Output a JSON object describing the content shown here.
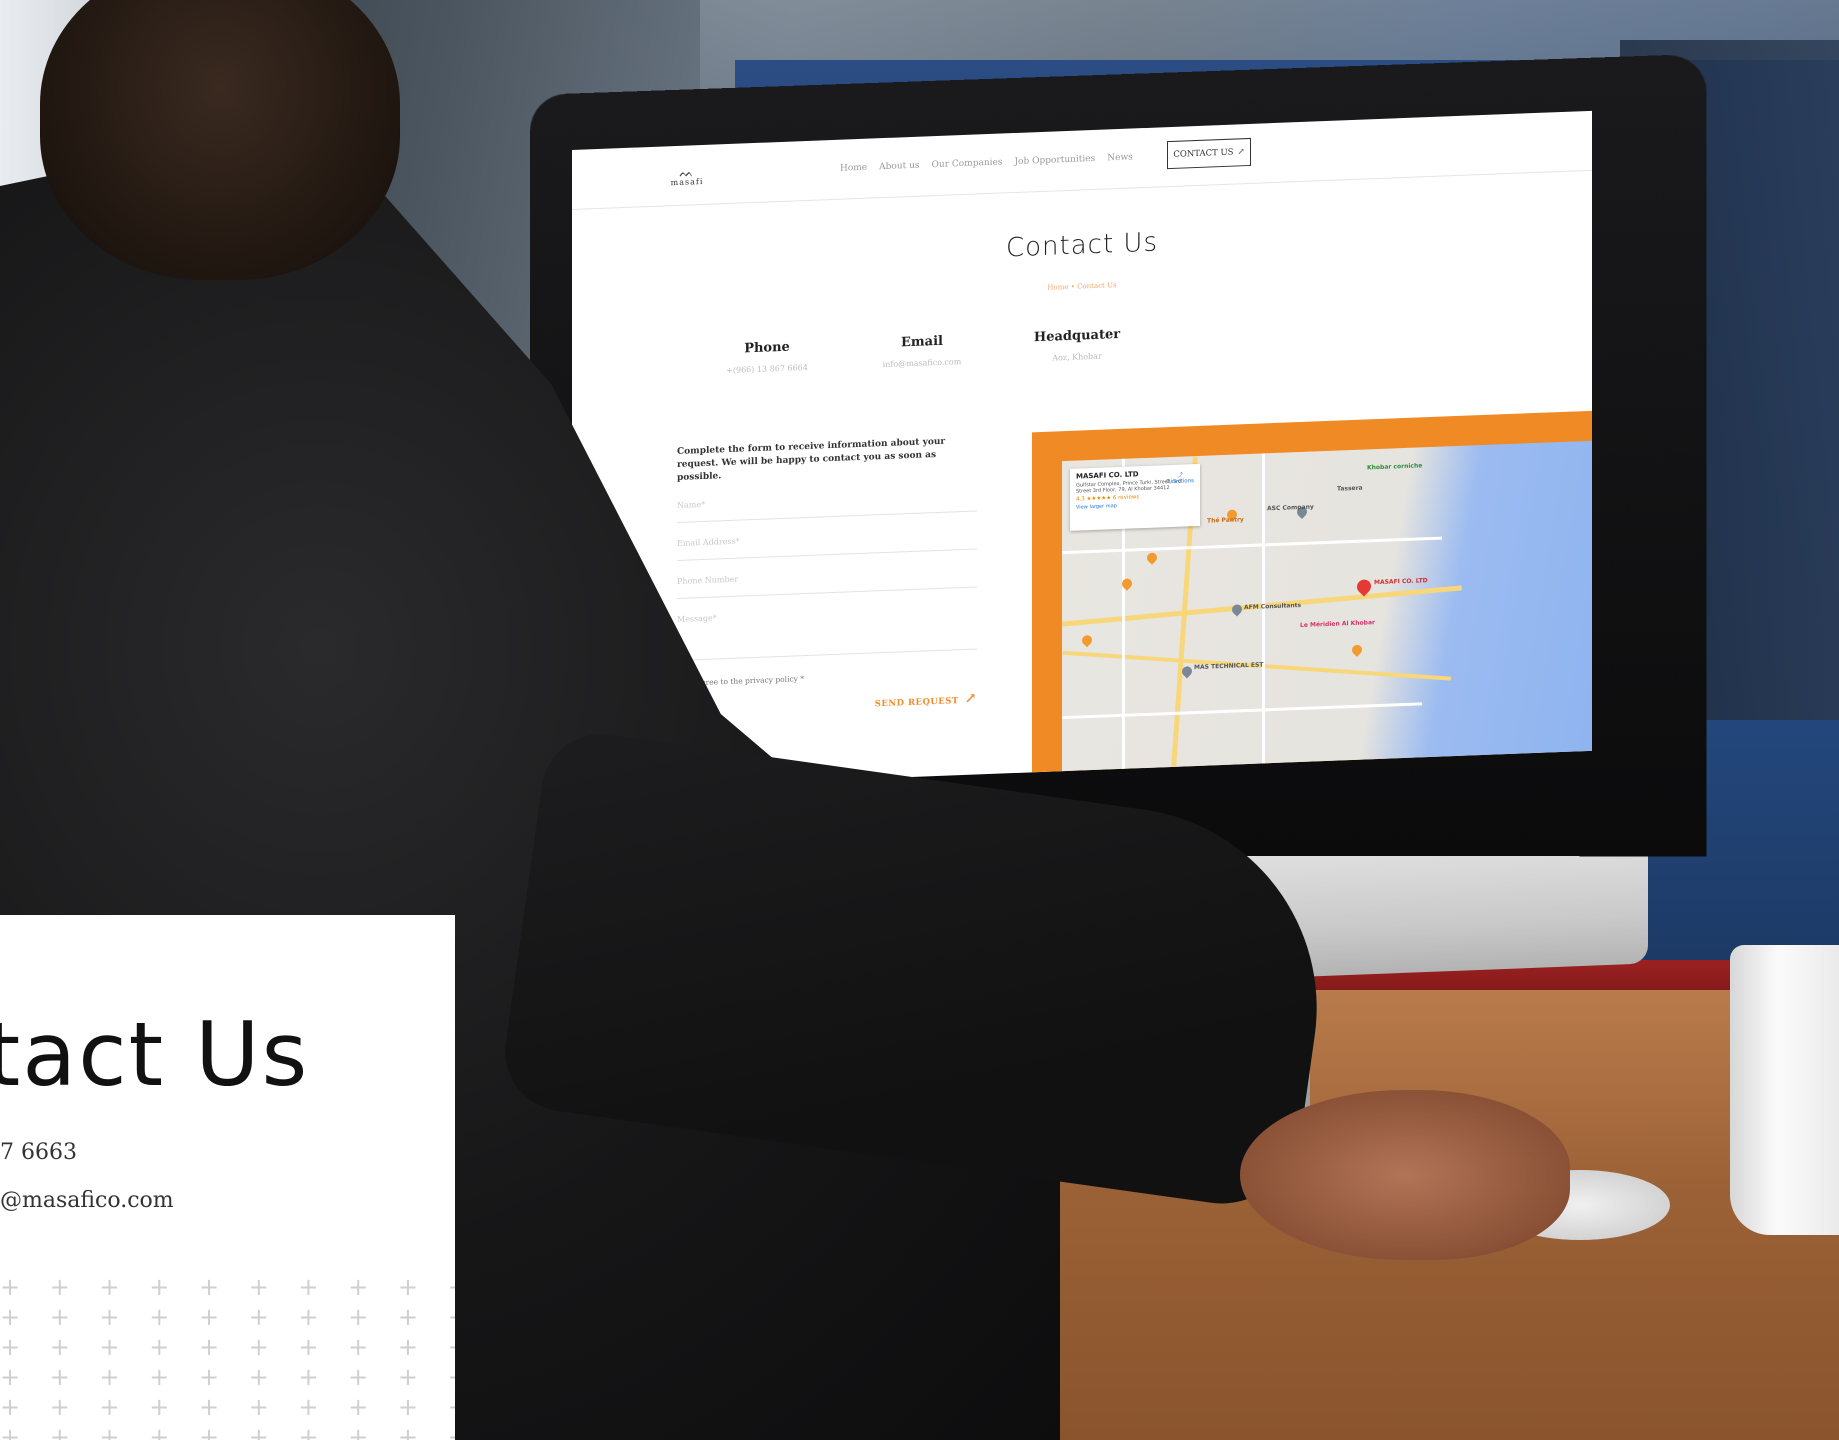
{
  "site": {
    "logo_text": "masafi",
    "nav": [
      "Home",
      "About us",
      "Our Companies",
      "Job Opportunities",
      "News"
    ],
    "cta": "CONTACT US",
    "title": "Contact Us",
    "breadcrumb": "Home  •  Contact Us",
    "info": [
      {
        "heading": "Phone",
        "value": "+(966) 13 867 6664"
      },
      {
        "heading": "Email",
        "value": "info@masafico.com"
      },
      {
        "heading": "Headquater",
        "value": "Aoz, Khobar"
      }
    ],
    "form": {
      "lead": "Complete the form to receive information about your request. We will be happy to contact you as soon as possible.",
      "name_placeholder": "Name*",
      "email_placeholder": "Email Address*",
      "phone_placeholder": "Phone Number",
      "message_placeholder": "Message*",
      "agree": "I agree to the privacy policy *",
      "submit": "SEND REQUEST"
    },
    "map": {
      "place": "MASAFI CO. LTD",
      "address": "Gulfstar Complex, Prince Turki, Street, 3rd Street 3rd Floor, 79, Al Khobar 34412",
      "rating": "4.3 ★★★★★  6 reviews",
      "larger": "View larger map",
      "directions": "Directions",
      "labels": [
        "ASC Company",
        "MASAFI CO. LTD",
        "AFM Consultants",
        "MAS TECHNICAL EST",
        "Le Méridien Al Khobar",
        "Thé Pantry",
        "Tassera",
        "Khobar corniche"
      ]
    }
  },
  "card": {
    "title": "ntact Us",
    "phone": "7 6663",
    "email": "@masafico.com"
  },
  "colors": {
    "accent": "#ef8a24",
    "text": "#222222"
  }
}
